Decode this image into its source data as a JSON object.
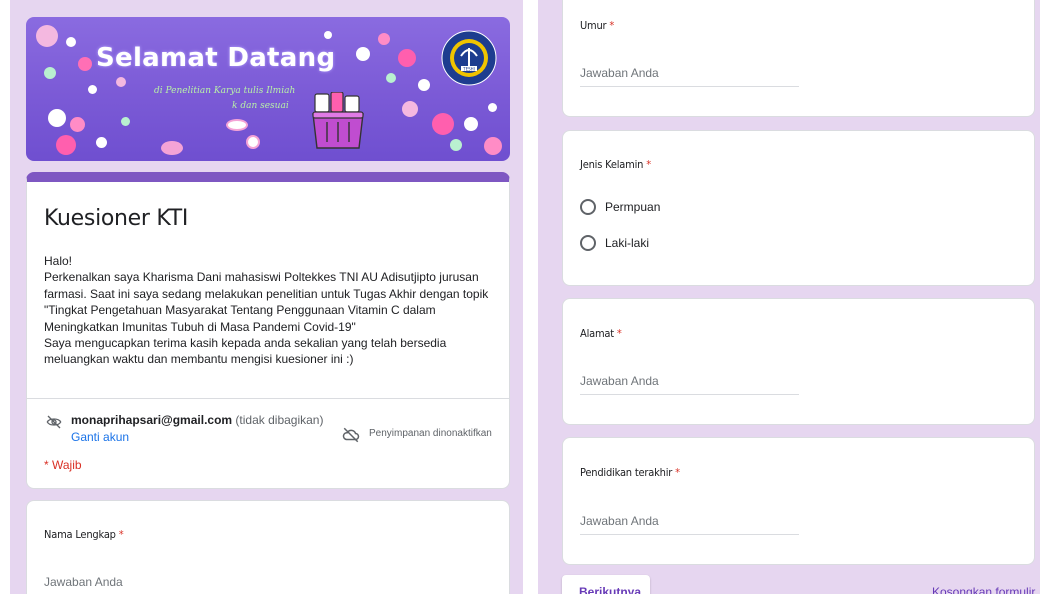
{
  "banner": {
    "title": "Selamat Datang",
    "subtitle_line1": "di Penelitian Karya tulis Ilmiah",
    "subtitle_line2": "k dan sesuai",
    "logo_text": "TESHI"
  },
  "form": {
    "title": "Kuesioner KTI",
    "description": [
      "Halo!",
      "Perkenalkan saya Kharisma Dani mahasiswi Poltekkes TNI AU Adisutjipto jurusan farmasi. Saat ini saya sedang melakukan penelitian untuk Tugas Akhir dengan topik \"Tingkat Pengetahuan Masyarakat Tentang Penggunaan Vitamin C dalam Meningkatkan Imunitas Tubuh di Masa Pandemi Covid-19\"",
      "Saya mengucapkan terima kasih kepada anda sekalian yang telah bersedia meluangkan waktu dan membantu mengisi kuesioner ini :)"
    ],
    "account_email": "monaprihapsari@gmail.com",
    "account_note": "(tidak dibagikan)",
    "switch_account": "Ganti akun",
    "save_status": "Penyimpanan dinonaktifkan",
    "required_note": "* Wajib",
    "accent_color": "#7e57c2",
    "background_color": "#e6d6f0"
  },
  "questions": {
    "nama": {
      "label": "Nama Lengkap",
      "required_mark": "*",
      "placeholder": "Jawaban Anda"
    },
    "umur": {
      "label": "Umur",
      "required_mark": "*",
      "placeholder": "Jawaban Anda"
    },
    "jenis_kelamin": {
      "label": "Jenis Kelamin",
      "required_mark": "*",
      "options": [
        "Permpuan",
        "Laki-laki"
      ]
    },
    "alamat": {
      "label": "Alamat",
      "required_mark": "*",
      "placeholder": "Jawaban Anda"
    },
    "pendidikan": {
      "label": "Pendidikan terakhir",
      "required_mark": "*",
      "placeholder": "Jawaban Anda"
    }
  },
  "footer": {
    "next_label": "Berikutnya",
    "clear_label": "Kosongkan formulir"
  },
  "icons": {
    "account": "eye-off-icon",
    "save": "cloud-off-icon"
  }
}
